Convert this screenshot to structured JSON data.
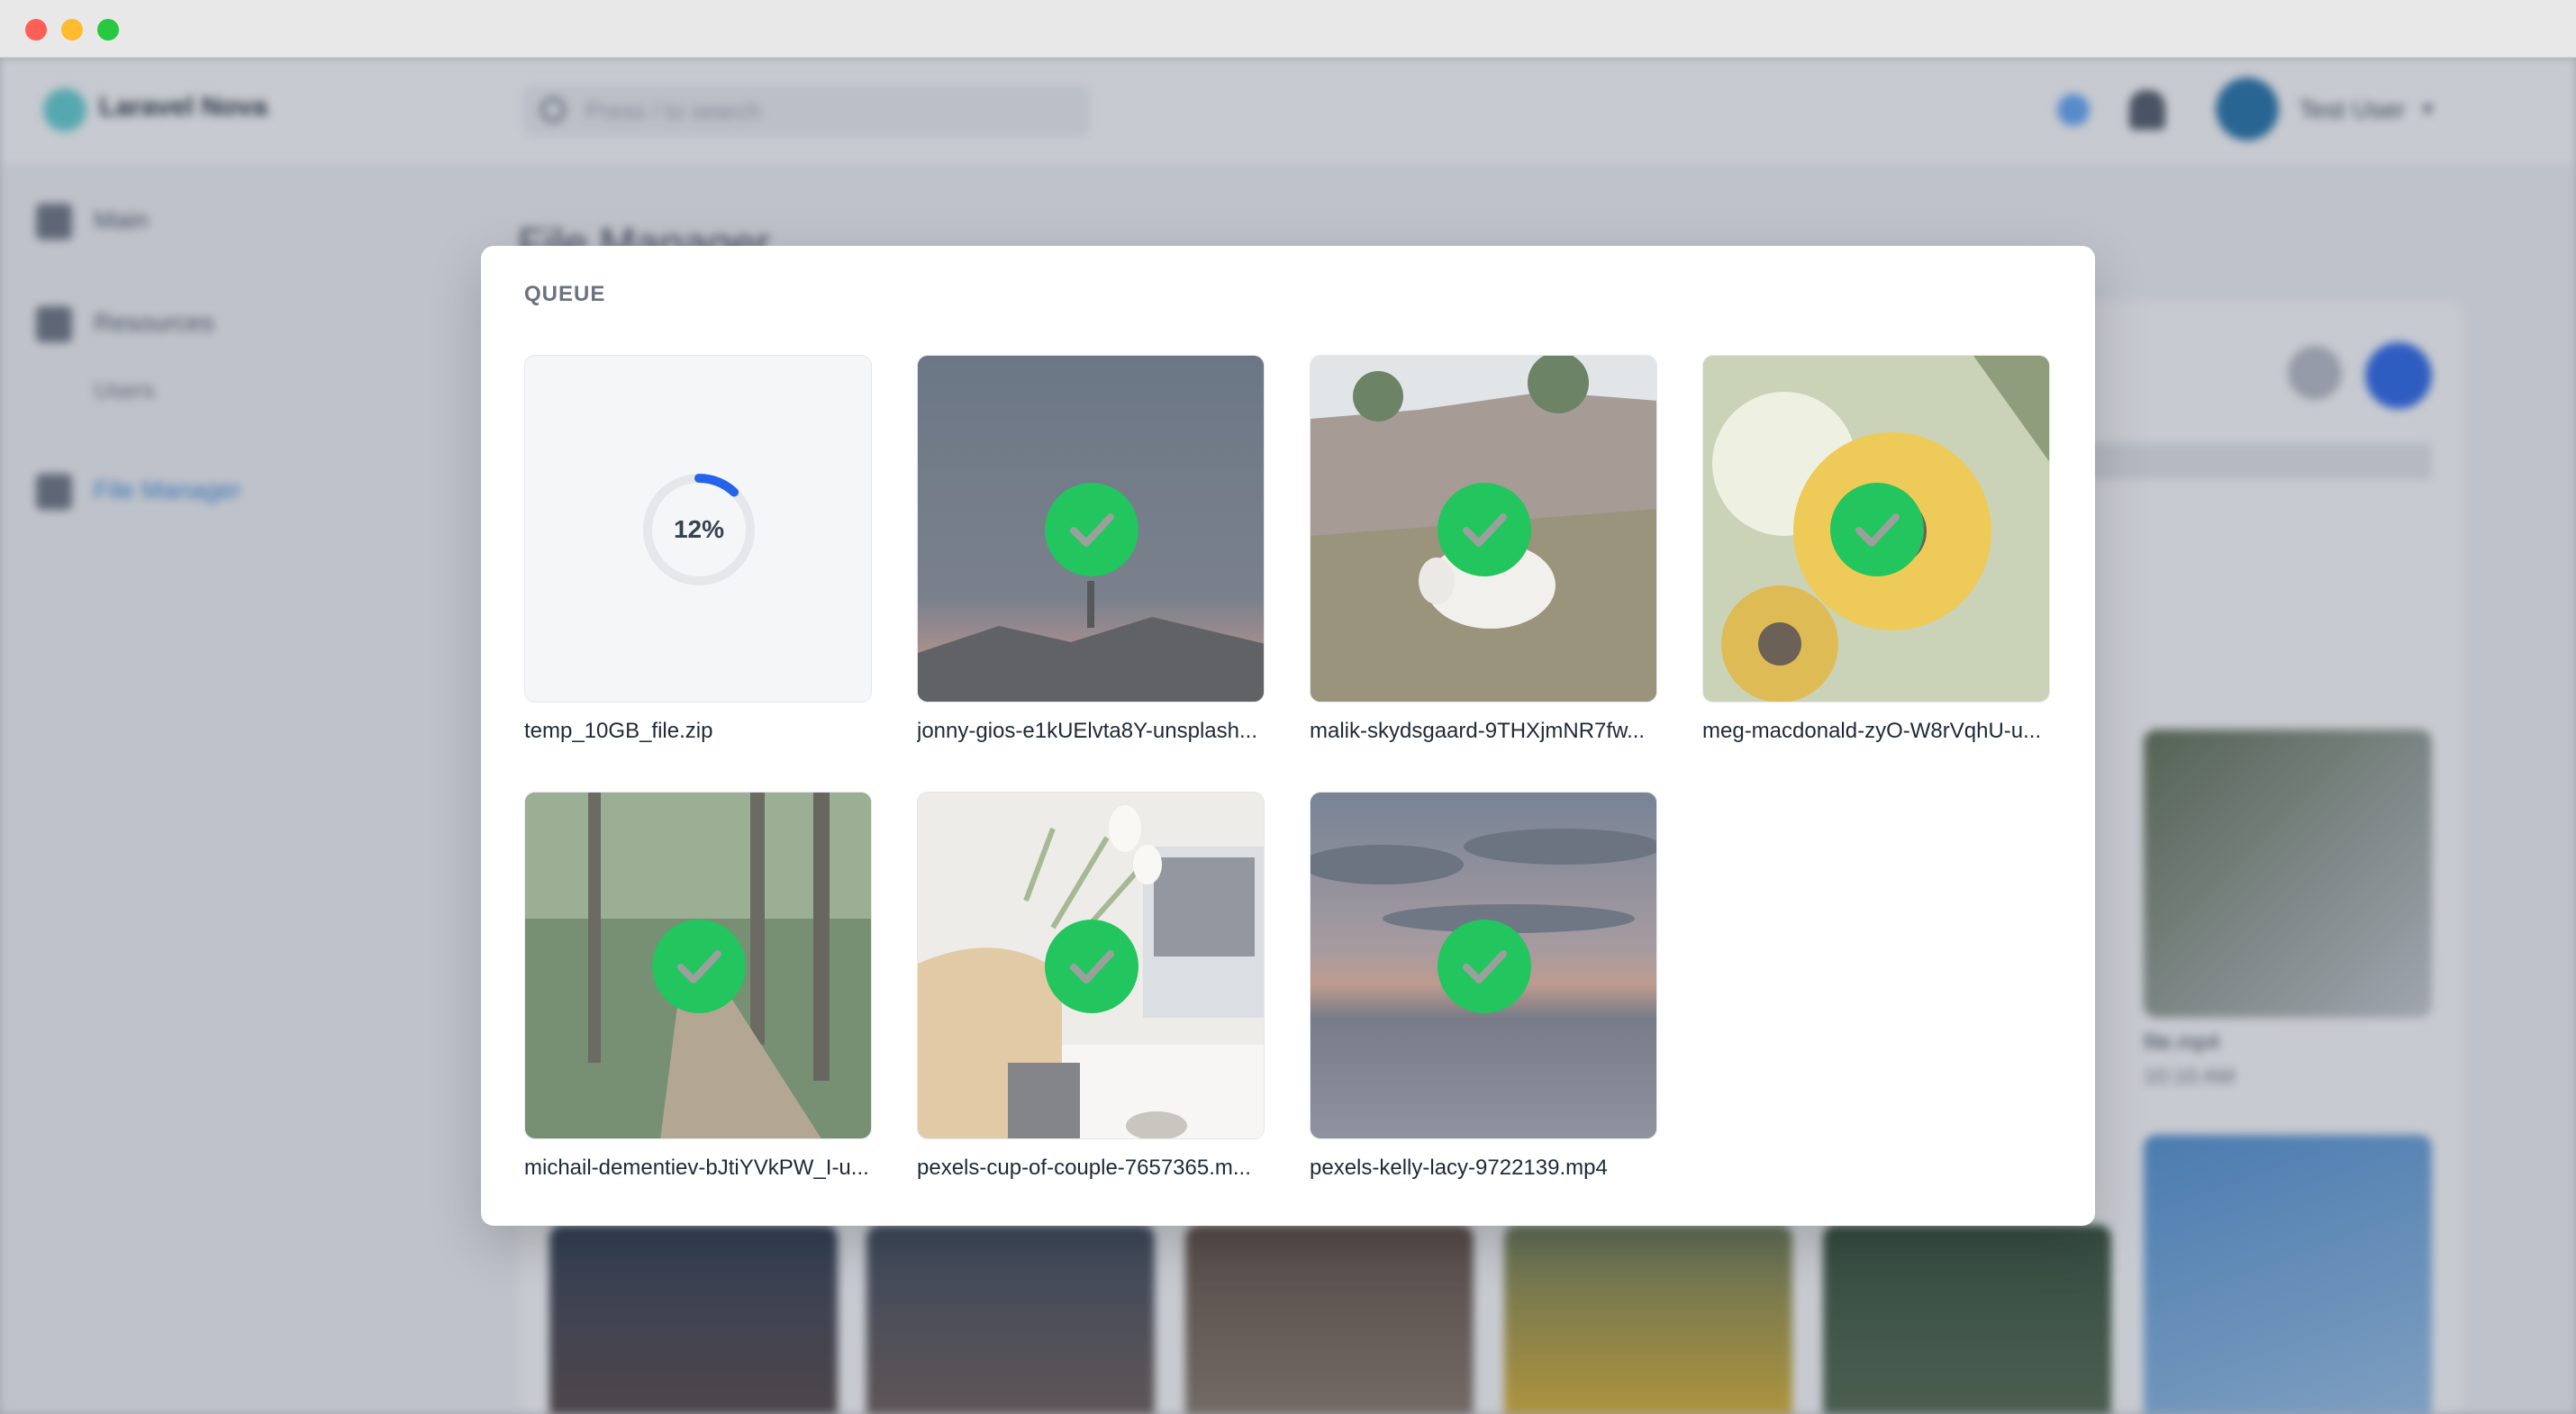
{
  "app": {
    "name": "Laravel Nova",
    "search_placeholder": "Press / to search",
    "user_name": "Test User",
    "page_title": "File Manager",
    "sidebar": {
      "main": "Main",
      "resources": "Resources",
      "users": "Users",
      "file_manager": "File Manager"
    },
    "background_files": [
      {
        "name": "file.mp4",
        "time": "10:10 AM"
      }
    ]
  },
  "queue": {
    "title": "QUEUE",
    "items": [
      {
        "name": "temp_10GB_file.zip",
        "status": "uploading",
        "progress_label": "12%",
        "progress": 0.12,
        "thumb": "file"
      },
      {
        "name": "jonny-gios-e1kUElvta8Y-unsplash...",
        "status": "done",
        "thumb": "night-sky"
      },
      {
        "name": "malik-skydsgaard-9THXjmNR7fw...",
        "status": "done",
        "thumb": "sheep-hill"
      },
      {
        "name": "meg-macdonald-zyO-W8rVqhU-u...",
        "status": "done",
        "thumb": "sunflower"
      },
      {
        "name": "michail-dementiev-bJtiYVkPW_I-u...",
        "status": "done",
        "thumb": "forest-path"
      },
      {
        "name": "pexels-cup-of-couple-7657365.m...",
        "status": "done",
        "thumb": "desk-tulips"
      },
      {
        "name": "pexels-kelly-lacy-9722139.mp4",
        "status": "done",
        "thumb": "dusk-sea"
      }
    ]
  },
  "colors": {
    "success": "#22c55e",
    "progress": "#2563eb",
    "accent": "#2f7fd6"
  }
}
